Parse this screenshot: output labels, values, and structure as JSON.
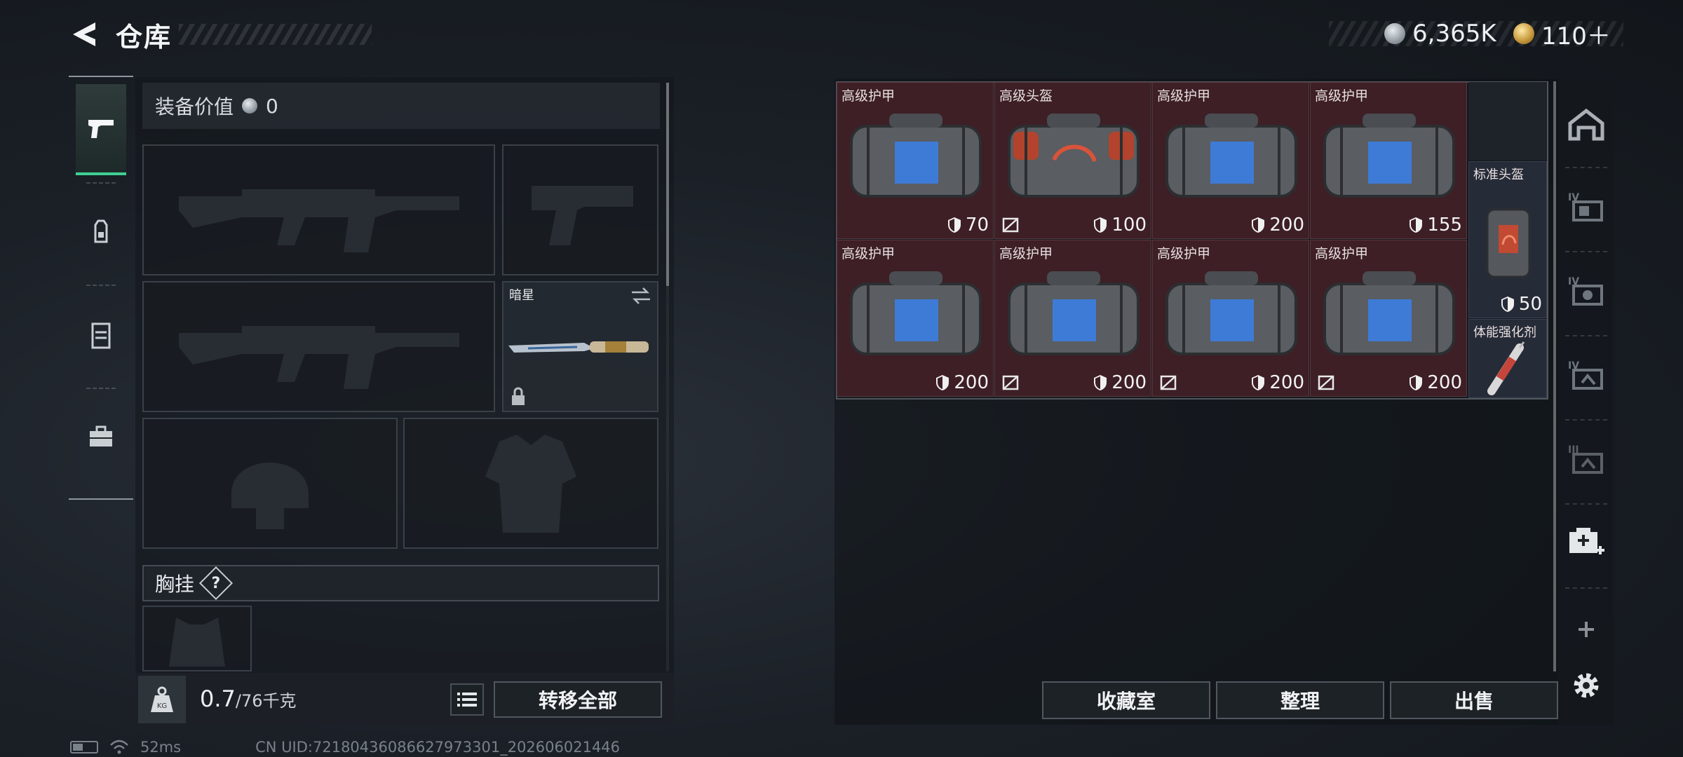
{
  "header": {
    "title": "仓库"
  },
  "currency": {
    "silver": "6,365K",
    "gold": "110＋"
  },
  "left": {
    "equip_value_label": "装备价值",
    "equip_value": "0",
    "knife_slot_label": "暗星",
    "chest_rig_label": "胸挂",
    "help_symbol": "?",
    "weight_current": "0.7",
    "weight_max": "/76千克",
    "transfer_all": "转移全部"
  },
  "grid": {
    "items": [
      {
        "name": "高级护甲",
        "value": "70",
        "no_repair": false,
        "color": "red"
      },
      {
        "name": "高级头盔",
        "value": "100",
        "no_repair": true,
        "color": "red"
      },
      {
        "name": "高级护甲",
        "value": "200",
        "no_repair": false,
        "color": "red"
      },
      {
        "name": "高级护甲",
        "value": "155",
        "no_repair": false,
        "color": "red"
      },
      {
        "name": "高级护甲",
        "value": "200",
        "no_repair": false,
        "color": "red"
      },
      {
        "name": "高级护甲",
        "value": "200",
        "no_repair": true,
        "color": "red"
      },
      {
        "name": "高级护甲",
        "value": "200",
        "no_repair": true,
        "color": "red"
      },
      {
        "name": "高级护甲",
        "value": "200",
        "no_repair": true,
        "color": "red"
      }
    ],
    "side_items": [
      {
        "name": "标准头盔",
        "value": "50",
        "color": "blue"
      },
      {
        "name": "体能强化剂",
        "value": "",
        "color": "blue"
      }
    ]
  },
  "buttons": {
    "collection": "收藏室",
    "organize": "整理",
    "sell": "出售"
  },
  "status": {
    "ping": "52ms",
    "uid": "CN UID:72180436086627973301_202606021446"
  },
  "colors": {
    "accent_green": "#3fcf93",
    "item_red": "#3d1f25",
    "item_blue": "#262b38"
  }
}
